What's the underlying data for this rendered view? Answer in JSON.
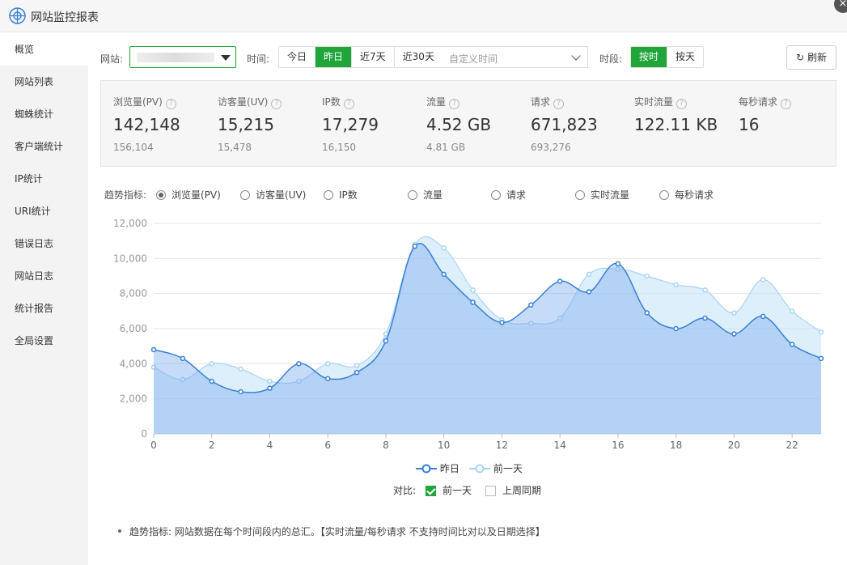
{
  "app": {
    "title": "网站监控报表"
  },
  "sidebar": {
    "items": [
      {
        "label": "概览",
        "active": true
      },
      {
        "label": "网站列表"
      },
      {
        "label": "蜘蛛统计"
      },
      {
        "label": "客户端统计"
      },
      {
        "label": "IP统计"
      },
      {
        "label": "URI统计"
      },
      {
        "label": "错误日志"
      },
      {
        "label": "网站日志"
      },
      {
        "label": "统计报告"
      },
      {
        "label": "全局设置"
      }
    ]
  },
  "toolbar": {
    "site_label": "网站:",
    "time_label": "时间:",
    "time_buttons": [
      "今日",
      "昨日",
      "近7天",
      "近30天"
    ],
    "time_selected": "昨日",
    "custom_time_placeholder": "自定义时间",
    "period_label": "时段:",
    "period_buttons": [
      "按时",
      "按天"
    ],
    "period_selected": "按时",
    "refresh_label": "刷新"
  },
  "stats": [
    {
      "name": "浏览量(PV)",
      "value": "142,148",
      "prev": "156,104"
    },
    {
      "name": "访客量(UV)",
      "value": "15,215",
      "prev": "15,478"
    },
    {
      "name": "IP数",
      "value": "17,279",
      "prev": "16,150"
    },
    {
      "name": "流量",
      "value": "4.52 GB",
      "prev": "4.81 GB"
    },
    {
      "name": "请求",
      "value": "671,823",
      "prev": "693,276"
    },
    {
      "name": "实时流量",
      "value": "122.11 KB",
      "prev": ""
    },
    {
      "name": "每秒请求",
      "value": "16",
      "prev": ""
    }
  ],
  "trend": {
    "label": "趋势指标:",
    "options": [
      "浏览量(PV)",
      "访客量(UV)",
      "IP数",
      "流量",
      "请求",
      "实时流量",
      "每秒请求"
    ],
    "selected": "浏览量(PV)"
  },
  "compare": {
    "label": "对比:",
    "options": [
      {
        "label": "前一天",
        "checked": true
      },
      {
        "label": "上周同期",
        "checked": false
      }
    ]
  },
  "note": "趋势指标: 网站数据在每个时间段内的总汇。【实时流量/每秒请求 不支持时间比对以及日期选择】",
  "colors": {
    "accent": "#20a53a",
    "series_today": "#3a7fd5",
    "series_prev": "#a8d4f5"
  },
  "chart_data": {
    "type": "area",
    "x": [
      0,
      1,
      2,
      3,
      4,
      5,
      6,
      7,
      8,
      9,
      10,
      11,
      12,
      13,
      14,
      15,
      16,
      17,
      18,
      19,
      20,
      21,
      22,
      23
    ],
    "xticks": [
      "0",
      "2",
      "4",
      "6",
      "8",
      "10",
      "12",
      "14",
      "16",
      "18",
      "20",
      "22"
    ],
    "yticks": [
      "0",
      "2,000",
      "4,000",
      "6,000",
      "8,000",
      "10,000",
      "12,000"
    ],
    "ylim": [
      0,
      12000
    ],
    "grid": true,
    "legend_position": "bottom",
    "series": [
      {
        "name": "昨日",
        "color": "#3a7fd5",
        "values": [
          4800,
          4300,
          3000,
          2400,
          2600,
          4000,
          3150,
          3500,
          5300,
          10700,
          9100,
          7500,
          6350,
          7350,
          8700,
          8100,
          9700,
          6900,
          6000,
          6600,
          5700,
          6700,
          5100,
          4300
        ]
      },
      {
        "name": "前一天",
        "color": "#a8d4f5",
        "values": [
          3800,
          3100,
          4000,
          3700,
          3000,
          3000,
          4000,
          3900,
          5700,
          10800,
          10600,
          8200,
          6500,
          6300,
          6600,
          9100,
          9400,
          9000,
          8500,
          8200,
          6900,
          8800,
          7000,
          5800
        ]
      }
    ]
  }
}
